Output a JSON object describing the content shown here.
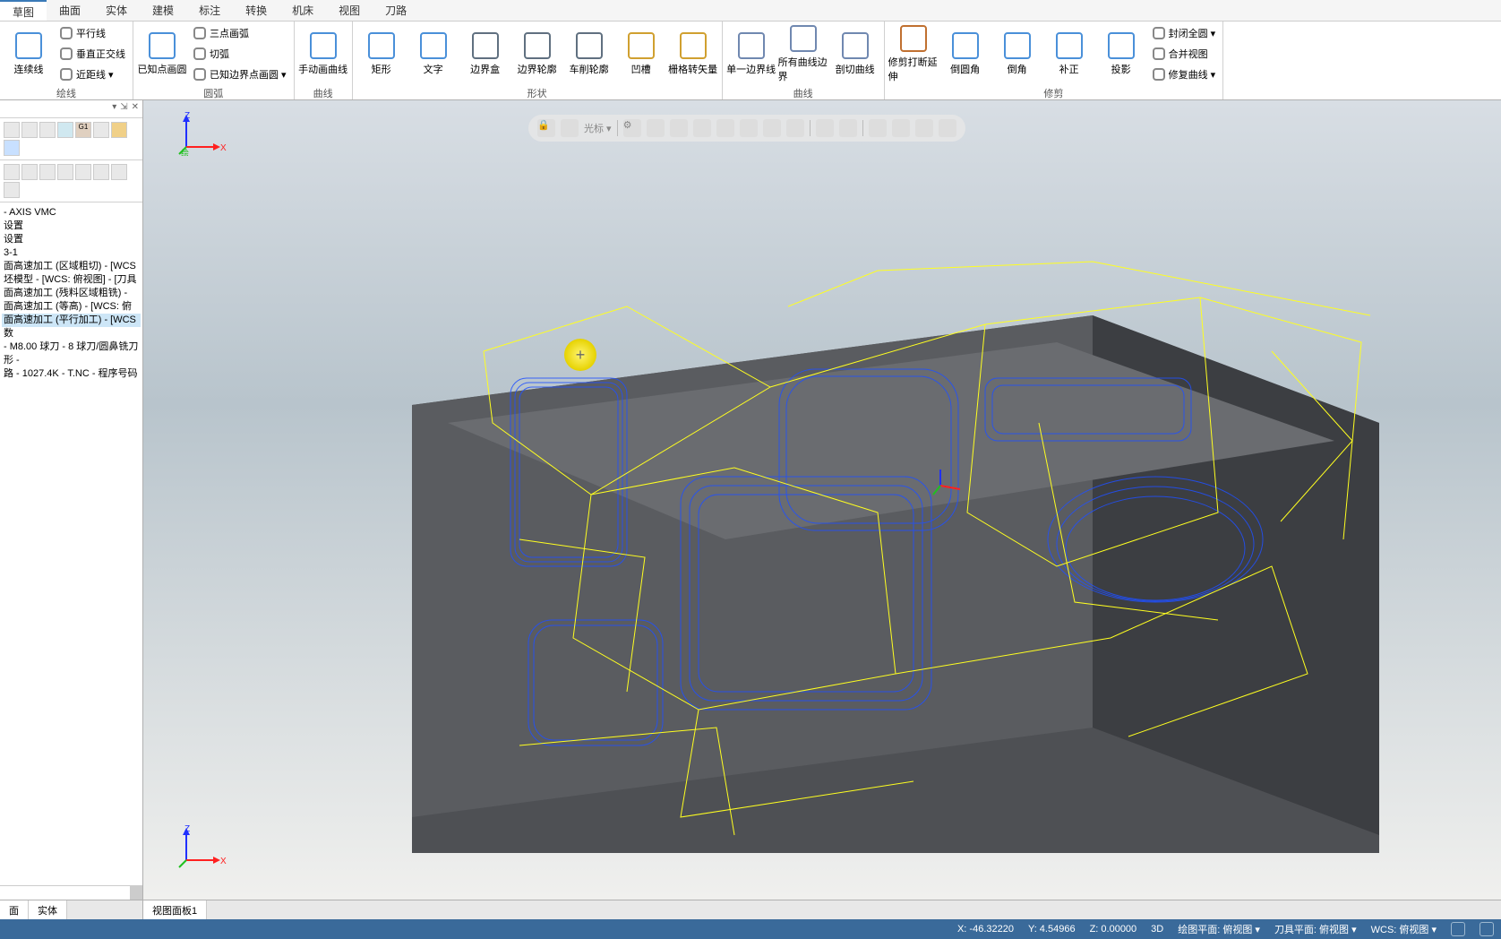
{
  "menu_tabs": [
    "草图",
    "曲面",
    "实体",
    "建模",
    "标注",
    "转换",
    "机床",
    "视图",
    "刀路"
  ],
  "menu_active_index": 0,
  "ribbon": {
    "groups": [
      {
        "label": "绘线",
        "big": [
          {
            "label": "连续线",
            "icon": "line-icon"
          }
        ],
        "small": [
          {
            "label": "平行线",
            "icon": "parallel-icon"
          },
          {
            "label": "垂直正交线",
            "icon": "perp-icon"
          },
          {
            "label": "近距线 ▾",
            "icon": "near-icon"
          }
        ]
      },
      {
        "label": "圆弧",
        "big": [
          {
            "label": "已知点画圆",
            "icon": "circle-icon"
          }
        ],
        "small": [
          {
            "label": "三点画弧",
            "icon": "arc3-icon"
          },
          {
            "label": "切弧",
            "icon": "tanarc-icon"
          },
          {
            "label": "已知边界点画圆 ▾",
            "icon": "boundcircle-icon"
          }
        ]
      },
      {
        "label": "曲线",
        "big": [
          {
            "label": "手动画曲线",
            "icon": "spline-icon"
          }
        ]
      },
      {
        "label": "形状",
        "big": [
          {
            "label": "矩形",
            "icon": "rect-icon"
          },
          {
            "label": "文字",
            "icon": "text-icon"
          },
          {
            "label": "边界盒",
            "icon": "bbox-icon"
          },
          {
            "label": "边界轮廓",
            "icon": "boundary-icon"
          },
          {
            "label": "车削轮廓",
            "icon": "turn-icon"
          },
          {
            "label": "凹槽",
            "icon": "groove-icon"
          },
          {
            "label": "栅格转矢量",
            "icon": "raster-icon"
          }
        ]
      },
      {
        "label": "曲线",
        "big": [
          {
            "label": "单一边界线",
            "icon": "single-edge-icon"
          },
          {
            "label": "所有曲线边界",
            "icon": "all-edge-icon"
          },
          {
            "label": "剖切曲线",
            "icon": "section-icon"
          }
        ]
      },
      {
        "label": "修剪",
        "big": [
          {
            "label": "修剪打断延伸",
            "icon": "trim-icon"
          },
          {
            "label": "倒圆角",
            "icon": "fillet-icon"
          },
          {
            "label": "倒角",
            "icon": "chamfer-icon"
          },
          {
            "label": "补正",
            "icon": "offset-icon"
          },
          {
            "label": "投影",
            "icon": "project-icon"
          }
        ],
        "small": [
          {
            "label": "封闭全圆 ▾",
            "icon": "closecircle-icon"
          },
          {
            "label": "合并视图",
            "icon": "merge-icon"
          },
          {
            "label": "修复曲线 ▾",
            "icon": "repair-icon"
          }
        ]
      }
    ]
  },
  "sidebar": {
    "pin_icons": [
      "▾",
      "⇲",
      "✕"
    ],
    "tree": [
      "- AXIS VMC",
      "",
      "设置",
      "设置",
      "3-1",
      "面高速加工 (区域粗切) - [WCS",
      "坯模型 - [WCS: 俯视图] - [刀具",
      "面高速加工 (残料区域粗铣) -",
      "面高速加工 (等高) - [WCS: 俯",
      "面高速加工 (平行加工) - [WCS",
      "数",
      "- M8.00 球刀 - 8 球刀/圆鼻铣刀",
      "形 -",
      "路 - 1027.4K - T.NC - 程序号码"
    ],
    "tree_selected_index": 9
  },
  "floating_toolbar": {
    "label": "光标 ▾"
  },
  "axis_labels": {
    "x": "X",
    "z": "Z",
    "sub": "绘"
  },
  "bottom_tabs_left": [
    "面",
    "实体"
  ],
  "bottom_tabs_right": [
    "视图面板1"
  ],
  "statusbar": {
    "x": "X: -46.32220",
    "y": "Y: 4.54966",
    "z": "Z: 0.00000",
    "mode": "3D",
    "draw_plane": "绘图平面: 俯视图 ▾",
    "tool_plane": "刀具平面: 俯视图 ▾",
    "wcs": "WCS: 俯视图 ▾"
  }
}
